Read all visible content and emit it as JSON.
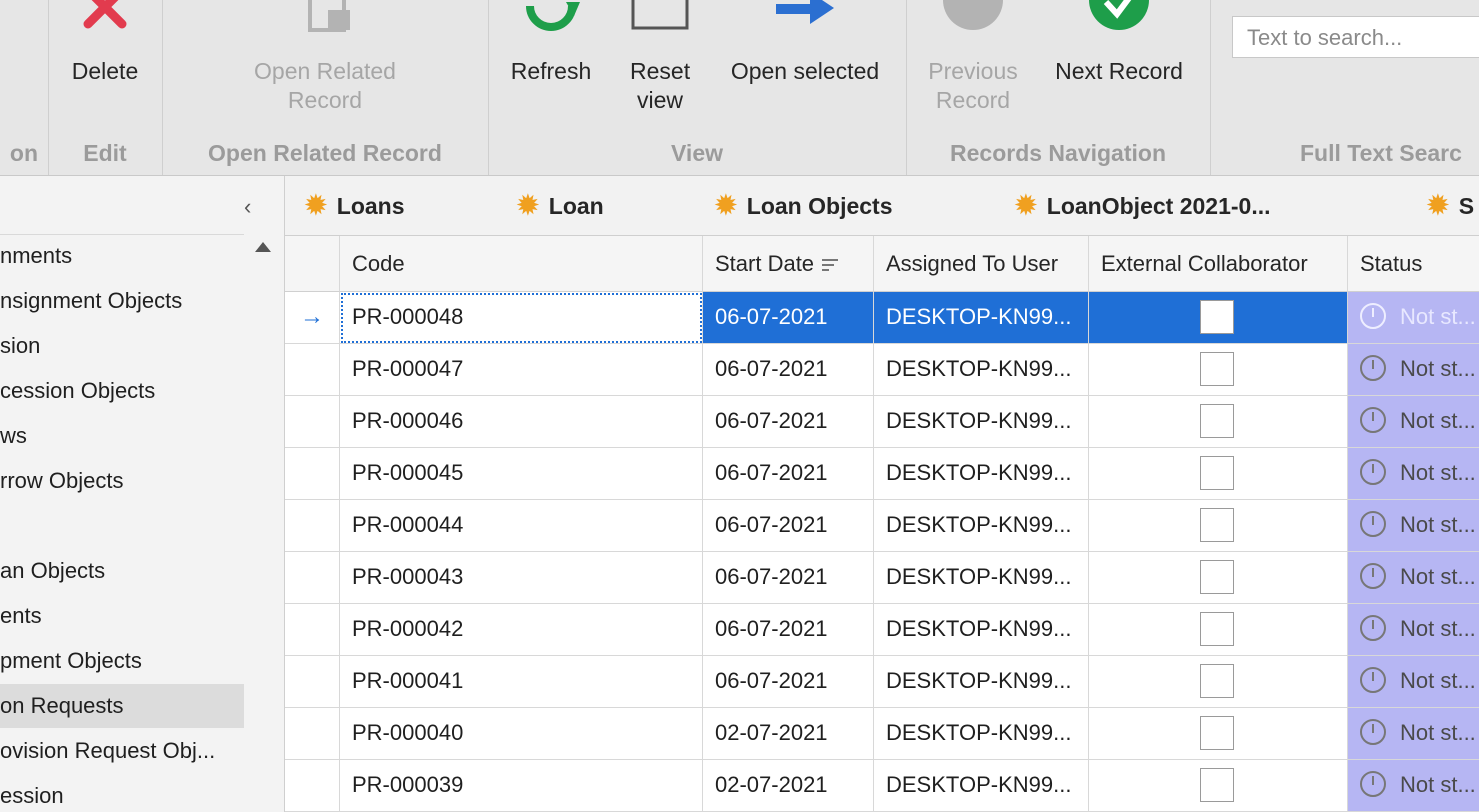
{
  "ribbon": {
    "groups": [
      {
        "caption": "on"
      },
      {
        "caption": "Edit"
      },
      {
        "caption": "Open Related Record"
      },
      {
        "caption": "View"
      },
      {
        "caption": "Records Navigation"
      },
      {
        "caption": "Full Text Searc"
      }
    ],
    "delete_label": "Delete",
    "open_related_label": "Open Related Record",
    "refresh_label": "Refresh",
    "reset_view_label": "Reset view",
    "open_selected_label": "Open selected",
    "previous_record_label": "Previous Record",
    "next_record_label": "Next Record",
    "search_placeholder": "Text to search..."
  },
  "nav": {
    "items": [
      {
        "label": "nments"
      },
      {
        "label": "nsignment Objects"
      },
      {
        "label": "sion"
      },
      {
        "label": "cession Objects"
      },
      {
        "label": "ws"
      },
      {
        "label": "rrow Objects"
      },
      {
        "label": ""
      },
      {
        "label": "an Objects"
      },
      {
        "label": "ents"
      },
      {
        "label": "pment Objects"
      },
      {
        "label": "on Requests"
      },
      {
        "label": "ovision Request Obj..."
      },
      {
        "label": "ession"
      }
    ],
    "selected_index": 10
  },
  "tabs": [
    {
      "label": "Loans"
    },
    {
      "label": "Loan"
    },
    {
      "label": "Loan Objects"
    },
    {
      "label": "LoanObject 2021-0..."
    },
    {
      "label": "S"
    }
  ],
  "grid": {
    "columns": {
      "code": "Code",
      "start_date": "Start Date",
      "assigned_to": "Assigned To User",
      "external": "External Collaborator",
      "status": "Status"
    },
    "rows": [
      {
        "code": "PR-000048",
        "start_date": "06-07-2021",
        "assigned": "DESKTOP-KN99...",
        "status": "Not st..."
      },
      {
        "code": "PR-000047",
        "start_date": "06-07-2021",
        "assigned": "DESKTOP-KN99...",
        "status": "Not st..."
      },
      {
        "code": "PR-000046",
        "start_date": "06-07-2021",
        "assigned": "DESKTOP-KN99...",
        "status": "Not st..."
      },
      {
        "code": "PR-000045",
        "start_date": "06-07-2021",
        "assigned": "DESKTOP-KN99...",
        "status": "Not st..."
      },
      {
        "code": "PR-000044",
        "start_date": "06-07-2021",
        "assigned": "DESKTOP-KN99...",
        "status": "Not st..."
      },
      {
        "code": "PR-000043",
        "start_date": "06-07-2021",
        "assigned": "DESKTOP-KN99...",
        "status": "Not st..."
      },
      {
        "code": "PR-000042",
        "start_date": "06-07-2021",
        "assigned": "DESKTOP-KN99...",
        "status": "Not st..."
      },
      {
        "code": "PR-000041",
        "start_date": "06-07-2021",
        "assigned": "DESKTOP-KN99...",
        "status": "Not st..."
      },
      {
        "code": "PR-000040",
        "start_date": "02-07-2021",
        "assigned": "DESKTOP-KN99...",
        "status": "Not st..."
      },
      {
        "code": "PR-000039",
        "start_date": "02-07-2021",
        "assigned": "DESKTOP-KN99...",
        "status": "Not st..."
      }
    ],
    "focused_row": 0,
    "focus_indicator": "→"
  },
  "colors": {
    "selection": "#1f6fd6",
    "status_bg": "#b6b6f3",
    "delete_icon": "#e23b4e",
    "refresh_icon": "#1e9e4a",
    "next_icon": "#1e9e4a",
    "open_selected_icon": "#2b6fd1",
    "tab_icon": "#f0a020"
  },
  "icons": [
    "delete-x-icon",
    "open-related-icon",
    "refresh-icon",
    "reset-view-icon",
    "open-selected-icon",
    "previous-record-icon",
    "next-record-icon",
    "gear-icon",
    "clock-icon",
    "sort-icon",
    "chevron-left-icon",
    "scroll-up-icon",
    "row-arrow-icon"
  ]
}
